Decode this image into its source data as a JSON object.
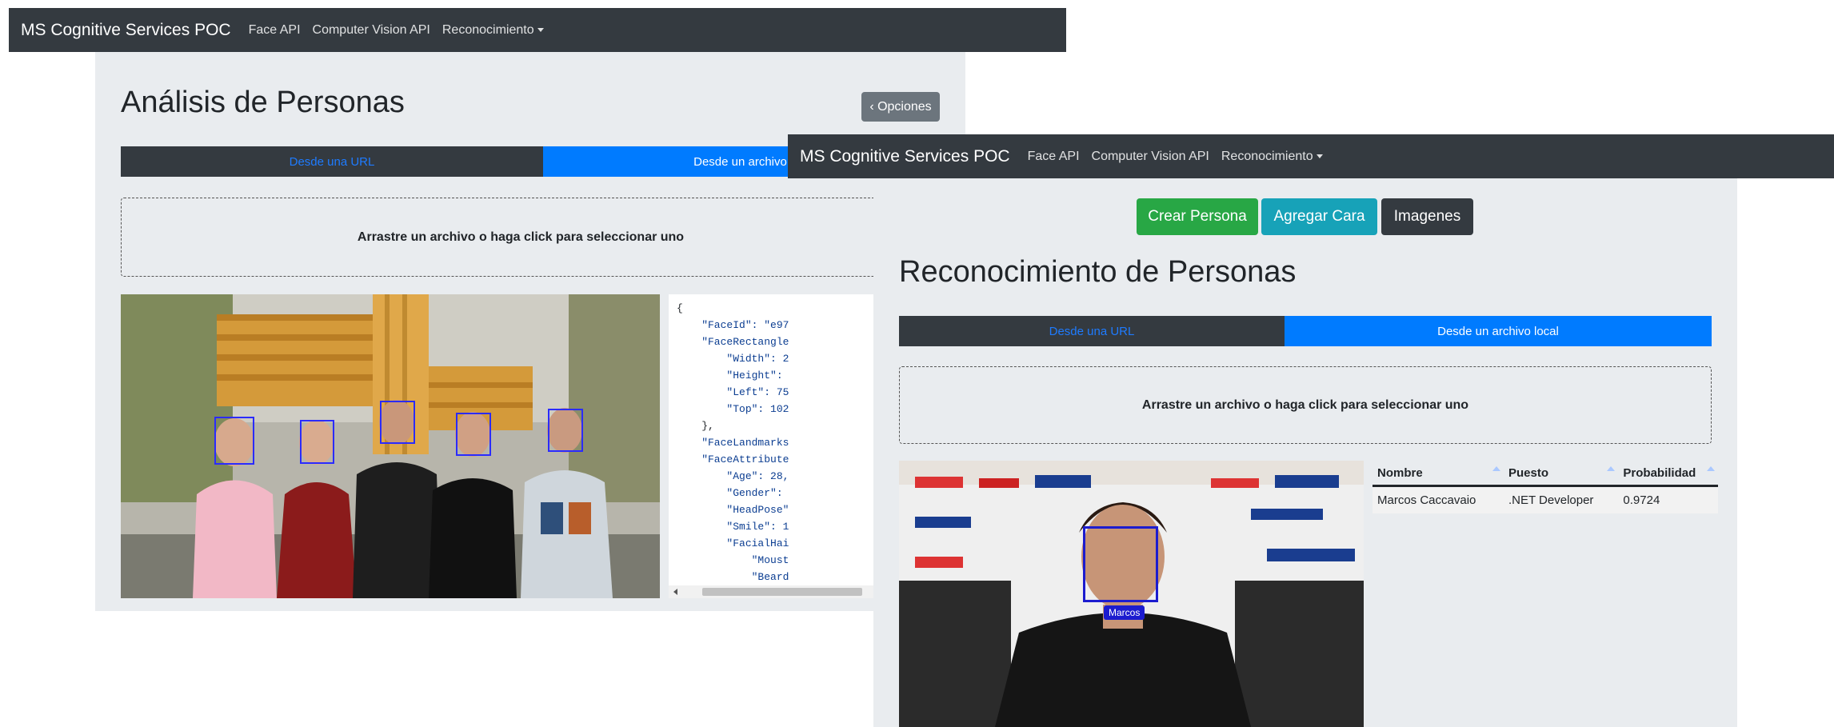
{
  "left_window": {
    "navbar": {
      "brand": "MS Cognitive Services POC",
      "links": [
        "Face API",
        "Computer Vision API",
        "Reconocimiento"
      ]
    },
    "options_button": "‹ Opciones",
    "title": "Análisis de Personas",
    "tabs": [
      "Desde una URL",
      "Desde un archivo local"
    ],
    "dropzone_text": "Arrastre un archivo o haga click para seleccionar uno",
    "json_lines": [
      "{",
      "    \"FaceId\": \"e97",
      "    \"FaceRectangle",
      "        \"Width\": 2",
      "        \"Height\":",
      "        \"Left\": 75",
      "        \"Top\": 102",
      "    },",
      "    \"FaceLandmarks",
      "    \"FaceAttribute",
      "        \"Age\": 28,",
      "        \"Gender\":",
      "        \"HeadPose\"",
      "        \"Smile\": 1",
      "        \"FacialHai",
      "            \"Moust",
      "            \"Beard"
    ]
  },
  "right_window": {
    "navbar": {
      "brand": "MS Cognitive Services POC",
      "links": [
        "Face API",
        "Computer Vision API",
        "Reconocimiento"
      ]
    },
    "buttons": [
      "Crear Persona",
      "Agregar Cara",
      "Imagenes"
    ],
    "title": "Reconocimiento de Personas",
    "tabs": [
      "Desde una URL",
      "Desde un archivo local"
    ],
    "dropzone_text": "Arrastre un archivo o haga click para seleccionar uno",
    "face_label": "Marcos",
    "table": {
      "headers": [
        "Nombre",
        "Puesto",
        "Probabilidad"
      ],
      "rows": [
        [
          "Marcos Caccavaio",
          ".NET Developer",
          "0.9724"
        ]
      ]
    }
  },
  "colors": {
    "navbar": "#343a40",
    "panel": "#e9ecef",
    "primary": "#007bff",
    "success": "#28a745",
    "info": "#17a2b8",
    "dark": "#343a40",
    "secondary": "#6c757d",
    "face_box": "#2b2bff"
  }
}
